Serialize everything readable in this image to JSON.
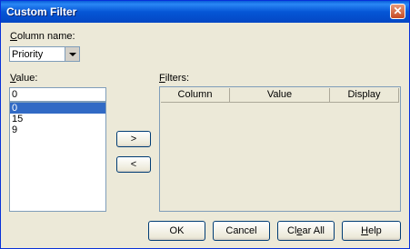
{
  "window": {
    "title": "Custom Filter"
  },
  "column_name": {
    "label_prefix": "C",
    "label_rest": "olumn name:",
    "selected": "Priority"
  },
  "value": {
    "label_prefix": "V",
    "label_rest": "alue:",
    "input": "0",
    "items": [
      "0",
      "15",
      "9"
    ],
    "selected_index": 0
  },
  "filters": {
    "label_prefix": "F",
    "label_rest": "ilters:",
    "columns": [
      "Column",
      "Value",
      "Display"
    ]
  },
  "buttons": {
    "add": ">",
    "remove": "<",
    "ok": "OK",
    "cancel": "Cancel",
    "clear_prefix": "Cl",
    "clear_u": "e",
    "clear_rest": "ar All",
    "help_u": "H",
    "help_rest": "elp"
  },
  "icons": {
    "close": "close-icon",
    "dropdown": "chevron-down-icon"
  },
  "colors": {
    "title_bar": "#0556d6",
    "selection": "#316ac5",
    "close": "#c74a24"
  }
}
